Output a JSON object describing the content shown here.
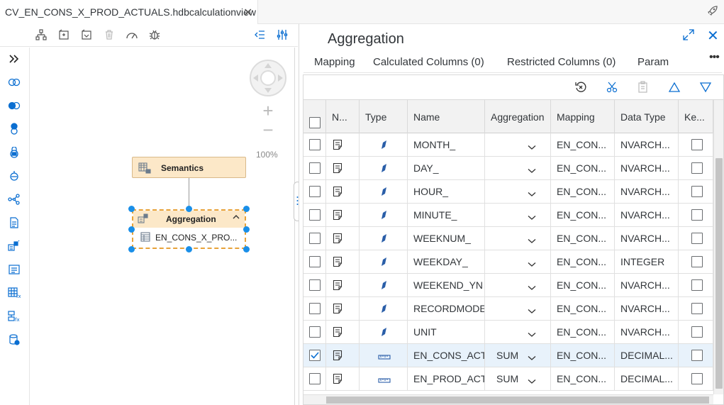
{
  "editor_tab": {
    "title": "CV_EN_CONS_X_PROD_ACTUALS.hdbcalculationview",
    "close": "✕"
  },
  "canvas": {
    "zoom_level": "100%",
    "zoom_in": "+",
    "zoom_out": "−",
    "semantics_node": {
      "label": "Semantics"
    },
    "aggregation_node": {
      "label": "Aggregation",
      "table_label": "EN_CONS_X_PRO..."
    }
  },
  "panel": {
    "title": "Aggregation",
    "close": "✕",
    "more": "•••",
    "tabs": [
      "Mapping",
      "Calculated Columns (0)",
      "Restricted Columns (0)",
      "Param"
    ],
    "columns": [
      "N...",
      "Type",
      "Name",
      "Aggregation",
      "Mapping",
      "Data Type",
      "Ke..."
    ],
    "rows": [
      {
        "type": "attribute",
        "name": "MONTH_",
        "aggregation": "",
        "mapping": "EN_CON...",
        "data_type": "NVARCH...",
        "checked": false,
        "key": false
      },
      {
        "type": "attribute",
        "name": "DAY_",
        "aggregation": "",
        "mapping": "EN_CON...",
        "data_type": "NVARCH...",
        "checked": false,
        "key": false
      },
      {
        "type": "attribute",
        "name": "HOUR_",
        "aggregation": "",
        "mapping": "EN_CON...",
        "data_type": "NVARCH...",
        "checked": false,
        "key": false
      },
      {
        "type": "attribute",
        "name": "MINUTE_",
        "aggregation": "",
        "mapping": "EN_CON...",
        "data_type": "NVARCH...",
        "checked": false,
        "key": false
      },
      {
        "type": "attribute",
        "name": "WEEKNUM_",
        "aggregation": "",
        "mapping": "EN_CON...",
        "data_type": "NVARCH...",
        "checked": false,
        "key": false
      },
      {
        "type": "attribute",
        "name": "WEEKDAY_",
        "aggregation": "",
        "mapping": "EN_CON...",
        "data_type": "INTEGER",
        "checked": false,
        "key": false
      },
      {
        "type": "attribute",
        "name": "WEEKEND_YN",
        "aggregation": "",
        "mapping": "EN_CON...",
        "data_type": "NVARCH...",
        "checked": false,
        "key": false
      },
      {
        "type": "attribute",
        "name": "RECORDMODE",
        "aggregation": "",
        "mapping": "EN_CON...",
        "data_type": "NVARCH...",
        "checked": false,
        "key": false
      },
      {
        "type": "attribute",
        "name": "UNIT",
        "aggregation": "",
        "mapping": "EN_CON...",
        "data_type": "NVARCH...",
        "checked": false,
        "key": false
      },
      {
        "type": "measure",
        "name": "EN_CONS_ACTUAL",
        "aggregation": "SUM",
        "mapping": "EN_CON...",
        "data_type": "DECIMAL...",
        "checked": true,
        "key": false
      },
      {
        "type": "measure",
        "name": "EN_PROD_ACTUAL",
        "aggregation": "SUM",
        "mapping": "EN_CON...",
        "data_type": "DECIMAL...",
        "checked": false,
        "key": false
      }
    ]
  },
  "colors": {
    "accent": "#0a6ed1",
    "node_fill": "#fce8c8",
    "selection_handle": "#1a8fe8",
    "selected_row": "#e8f2fb",
    "attribute_icon": "#2a5ea8"
  }
}
